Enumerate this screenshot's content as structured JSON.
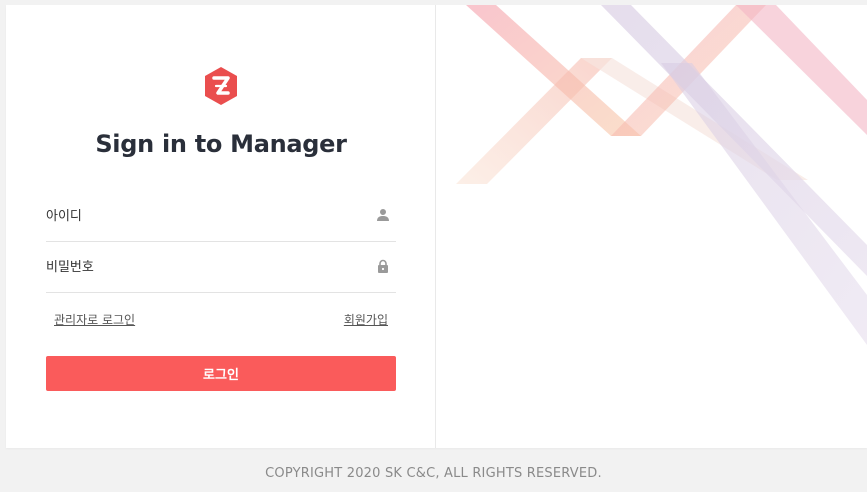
{
  "login": {
    "title": "Sign in to Manager",
    "id_placeholder": "아이디",
    "password_placeholder": "비밀번호",
    "admin_login_link": "관리자로 로그인",
    "signup_link": "회원가입",
    "login_button": "로그인"
  },
  "footer": {
    "copyright": "COPYRIGHT 2020 SK C&C, ALL RIGHTS RESERVED."
  },
  "icons": {
    "logo": "z-hexagon-logo-icon",
    "id_field": "user-icon",
    "password_field": "lock-icon"
  },
  "colors": {
    "accent": "#fa5b5b",
    "logo": "#ea4e4e",
    "title": "#2a2f3a",
    "background": "#f2f2f2"
  }
}
